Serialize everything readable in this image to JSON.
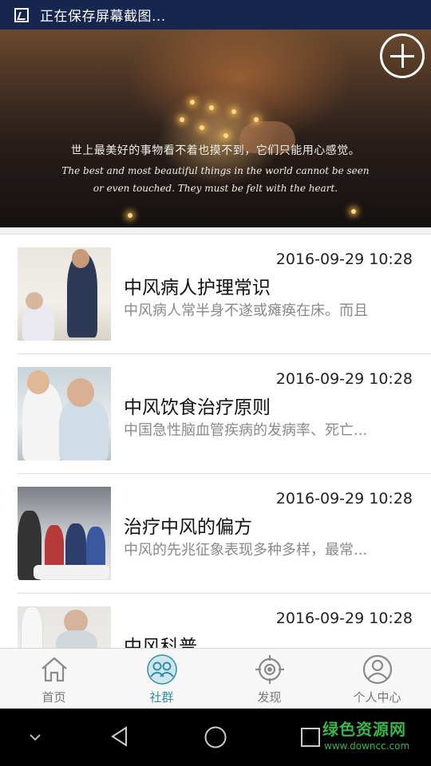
{
  "status_bar": {
    "text": "正在保存屏幕截图..."
  },
  "banner": {
    "quote_cn": "世上最美好的事物看不着也摸不到，它们只能用心感觉。",
    "quote_en_line1": "The best and most beautiful things in the world cannot be seen",
    "quote_en_line2": "or even touched. They must be felt with the heart."
  },
  "articles": [
    {
      "date": "2016-09-29 10:28",
      "title": "中风病人护理常识",
      "desc": "中风病人常半身不遂或瘫痪在床。而且"
    },
    {
      "date": "2016-09-29 10:28",
      "title": "中风饮食治疗原则",
      "desc": "中国急性脑血管疾病的发病率、死亡..."
    },
    {
      "date": "2016-09-29 10:28",
      "title": "治疗中风的偏方",
      "desc": "中风的先兆征象表现多种多样，最常..."
    },
    {
      "date": "2016-09-29 10:28",
      "title": "中风科普",
      "desc": ""
    }
  ],
  "tabs": [
    {
      "label": "首页",
      "icon": "home-icon"
    },
    {
      "label": "社群",
      "icon": "community-icon",
      "active": true
    },
    {
      "label": "发现",
      "icon": "discover-target-icon"
    },
    {
      "label": "个人中心",
      "icon": "profile-icon"
    }
  ],
  "watermark": {
    "cn": "绿色资源网",
    "url": "www.downcc.com"
  },
  "colors": {
    "status_bar": "#16264f",
    "active_tab": "#2f8fa6",
    "watermark": "#3bb54a"
  }
}
